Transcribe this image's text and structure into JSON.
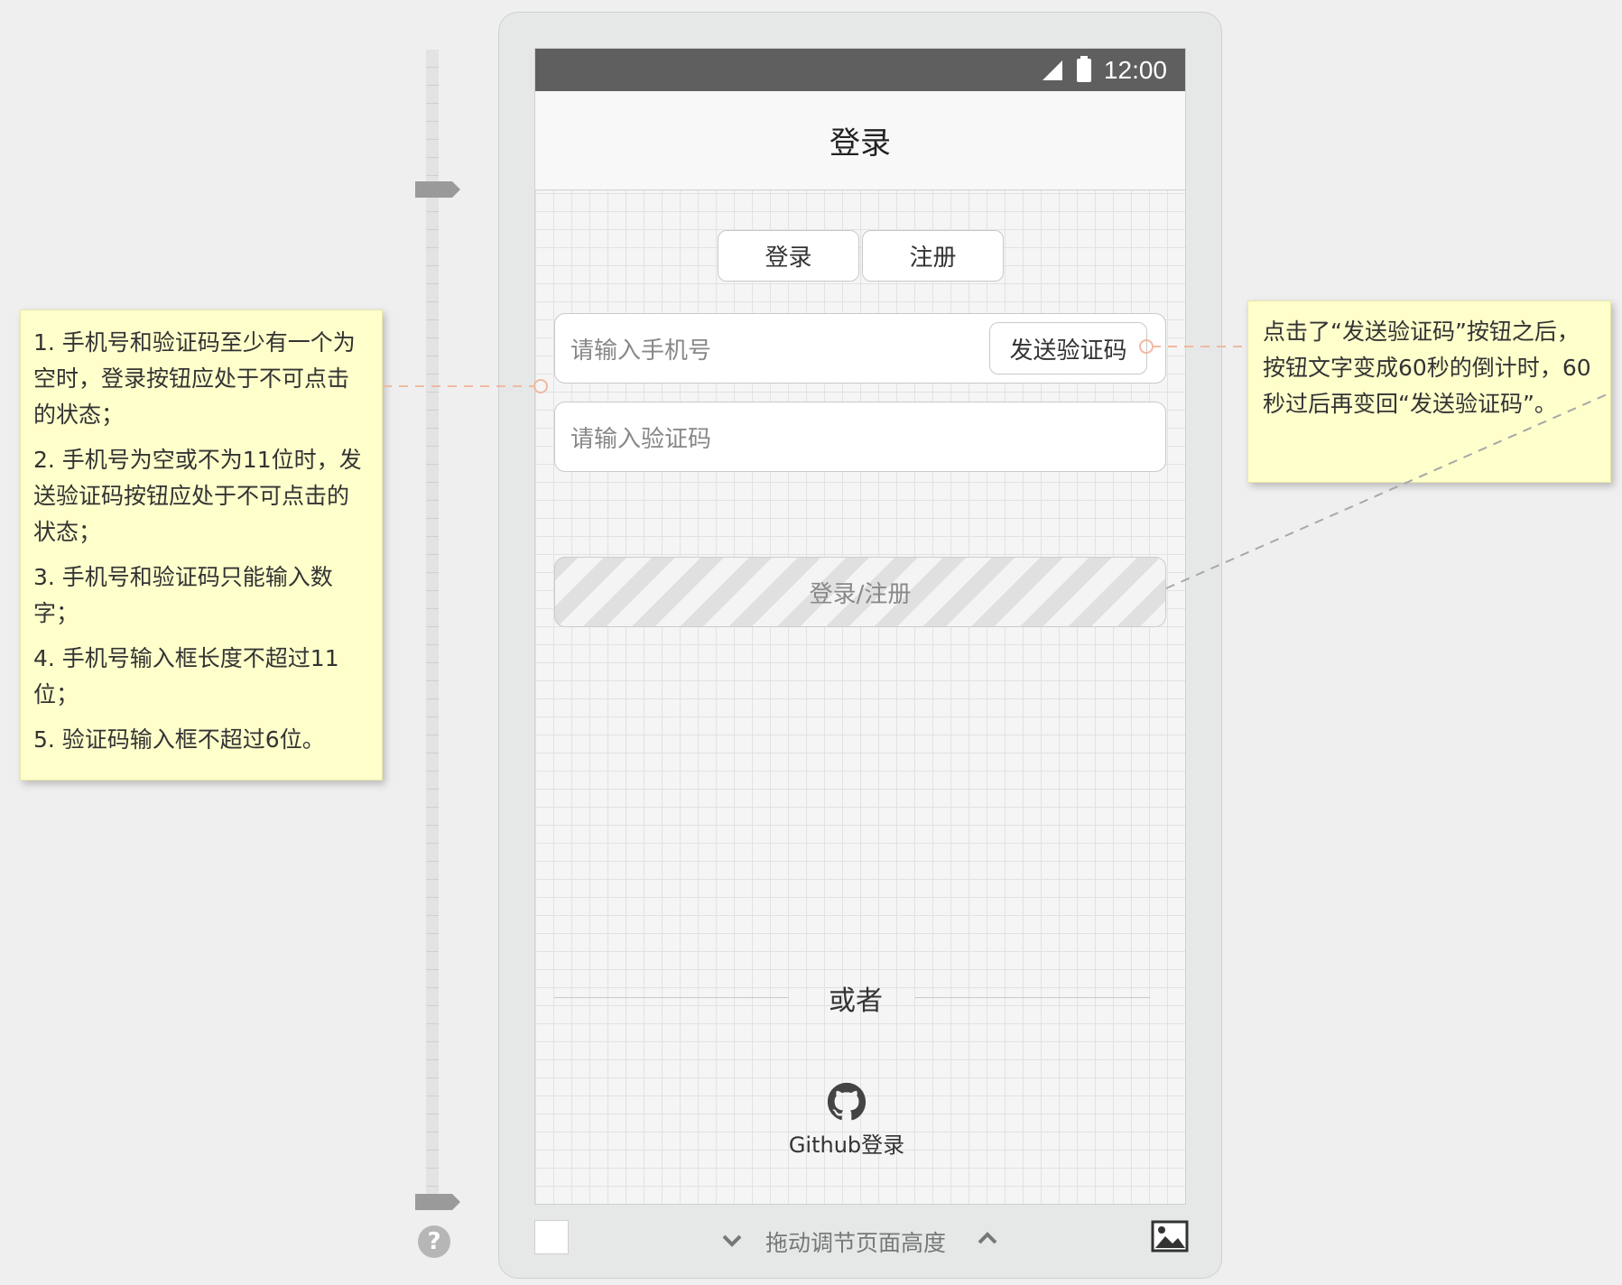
{
  "status_bar": {
    "time": "12:00"
  },
  "nav": {
    "title": "登录"
  },
  "tabs": [
    {
      "label": "登录"
    },
    {
      "label": "注册"
    }
  ],
  "phone_input": {
    "placeholder": "请输入手机号",
    "send_code_label": "发送验证码"
  },
  "code_input": {
    "placeholder": "请输入验证码"
  },
  "submit": {
    "label": "登录/注册"
  },
  "divider": {
    "text": "或者"
  },
  "github": {
    "label": "Github登录"
  },
  "bottom_bar": {
    "label": "拖动调节页面高度"
  },
  "notes": {
    "left": [
      "1. 手机号和验证码至少有一个为空时，登录按钮应处于不可点击的状态；",
      "2. 手机号为空或不为11位时，发送验证码按钮应处于不可点击的状态；",
      "3. 手机号和验证码只能输入数字；",
      "4. 手机号输入框长度不超过11位；",
      "5. 验证码输入框不超过6位。"
    ],
    "right": "点击了“发送验证码”按钮之后，按钮文字变成60秒的倒计时，60秒过后再变回“发送验证码”。"
  },
  "icons": {
    "signal": "signal-icon",
    "battery": "battery-icon",
    "github": "github-icon",
    "help": "help-icon",
    "image": "image-icon",
    "chevron_down": "chevron-down-icon",
    "chevron_up": "chevron-up-icon"
  },
  "colors": {
    "status_bar": "#5f5f5f",
    "note_bg": "#ffffcc",
    "connector_left": "#f0b9a0",
    "connector_right": "#a8a8a8"
  }
}
